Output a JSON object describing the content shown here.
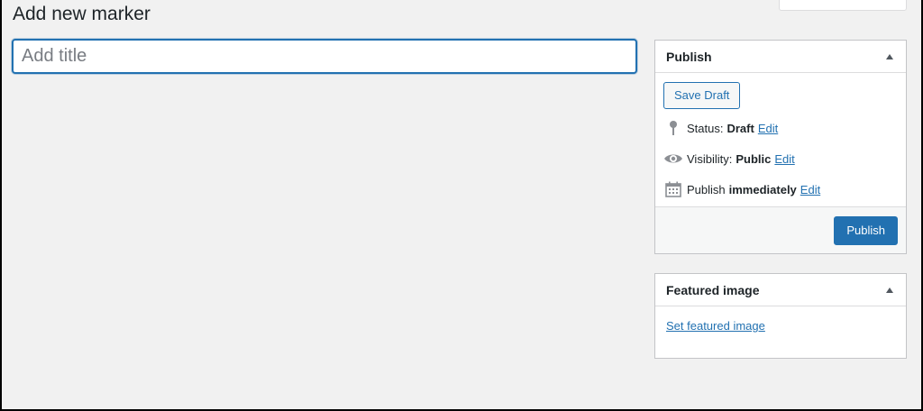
{
  "page": {
    "title": "Add new marker"
  },
  "title_input": {
    "placeholder": "Add title",
    "value": ""
  },
  "publish_box": {
    "title": "Publish",
    "save_draft_label": "Save Draft",
    "status": {
      "label": "Status:",
      "value": "Draft",
      "edit": "Edit"
    },
    "visibility": {
      "label": "Visibility:",
      "value": "Public",
      "edit": "Edit"
    },
    "schedule": {
      "label": "Publish",
      "value": "immediately",
      "edit": "Edit"
    },
    "publish_label": "Publish"
  },
  "featured_box": {
    "title": "Featured image",
    "link_label": "Set featured image"
  },
  "icons": {
    "status": "pin-icon",
    "visibility": "eye-icon",
    "schedule": "calendar-icon",
    "toggle": "triangle-up-icon"
  },
  "colors": {
    "accent": "#2271b1",
    "background": "#f1f1f1",
    "panel": "#ffffff",
    "border": "#c3c4c7"
  }
}
